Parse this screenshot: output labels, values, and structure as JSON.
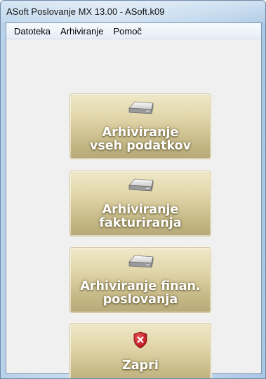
{
  "window": {
    "title": "ASoft Poslovanje MX 13.00 - ASoft.k09"
  },
  "menu": {
    "items": [
      {
        "label": "Datoteka"
      },
      {
        "label": "Arhiviranje"
      },
      {
        "label": "Pomoč"
      }
    ]
  },
  "buttons": [
    {
      "line1": "Arhiviranje",
      "line2": "vseh podatkov",
      "icon": "hard-drive-icon"
    },
    {
      "line1": "Arhiviranje",
      "line2": "fakturiranja",
      "icon": "hard-drive-icon"
    },
    {
      "line1": "Arhiviranje finan.",
      "line2": "poslovanja",
      "icon": "hard-drive-icon"
    },
    {
      "line1": "Zapri",
      "line2": "",
      "icon": "red-shield-close-icon"
    }
  ],
  "colors": {
    "button_top": "#efe8c8",
    "button_bottom": "#b6a877",
    "shield_red": "#c8161d"
  }
}
